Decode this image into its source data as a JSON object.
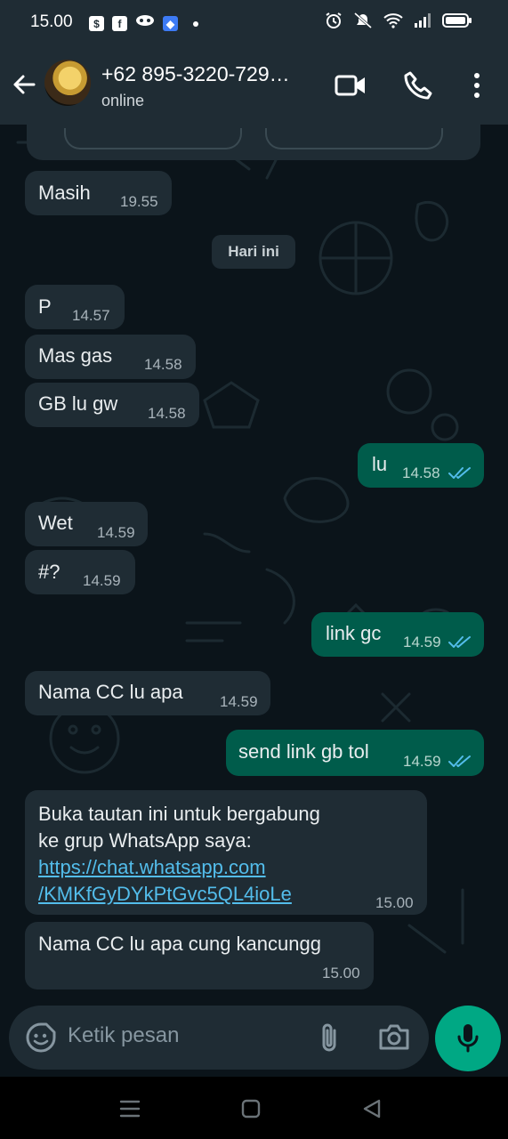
{
  "status_bar": {
    "time": "15.00",
    "left_icons": [
      "shopping-bag-icon",
      "facebook-icon",
      "game-app-icon",
      "app-icon",
      "notification-dot-icon"
    ],
    "right_icons": [
      "alarm-icon",
      "mute-icon",
      "wifi-icon",
      "signal-icon",
      "battery-icon"
    ]
  },
  "header": {
    "contact_name": "+62 895-3220-729…",
    "status": "online"
  },
  "date_chip": "Hari ini",
  "messages": [
    {
      "dir": "in",
      "text": "Masih",
      "time": "19.55"
    },
    {
      "dir": "in",
      "text": "P",
      "time": "14.57"
    },
    {
      "dir": "in",
      "text": "Mas gas",
      "time": "14.58"
    },
    {
      "dir": "in",
      "text": "GB lu gw",
      "time": "14.58"
    },
    {
      "dir": "out",
      "text": "lu",
      "time": "14.58",
      "read": true
    },
    {
      "dir": "in",
      "text": "Wet",
      "time": "14.59"
    },
    {
      "dir": "in",
      "text": "#?",
      "time": "14.59"
    },
    {
      "dir": "out",
      "text": "link gc",
      "time": "14.59",
      "read": true
    },
    {
      "dir": "in",
      "text": "Nama CC lu apa",
      "time": "14.59"
    },
    {
      "dir": "out",
      "text": "send link gb tol",
      "time": "14.59",
      "read": true
    },
    {
      "dir": "in",
      "lines": [
        "Buka tautan ini untuk bergabung",
        "ke grup WhatsApp saya:"
      ],
      "link_lines": [
        "https://chat.whatsapp.com",
        "/KMKfGyDYkPtGvc5QL4ioLe"
      ],
      "time": "15.00"
    },
    {
      "dir": "in",
      "text": "Nama CC lu apa cung kancungg",
      "time": "15.00"
    }
  ],
  "input": {
    "placeholder": "Ketik pesan"
  },
  "colors": {
    "background": "#0b141a",
    "bar": "#1f2c34",
    "incoming_bubble": "#1f2c34",
    "outgoing_bubble": "#005c4b",
    "accent_green": "#00a884",
    "read_tick_blue": "#53bdeb"
  }
}
